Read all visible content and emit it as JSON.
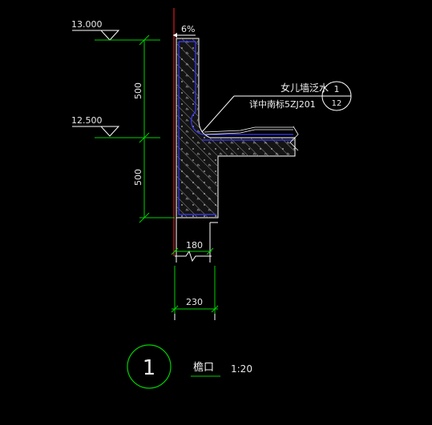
{
  "elevations": {
    "top": "13.000",
    "middle": "12.500"
  },
  "dimensions": {
    "upper_height": "500",
    "lower_height": "500",
    "parapet_thickness": "180",
    "wall_thickness": "230"
  },
  "slope": "6%",
  "annotations": {
    "parapet_waterproof": "女儿墙泛水",
    "reference": "详中南标5ZJ201"
  },
  "detail_reference": {
    "number": "1",
    "sheet": "12"
  },
  "title": {
    "number": "1",
    "name": "檐口",
    "scale": "1:20"
  },
  "colors": {
    "background": "#000000",
    "concrete_outline": "#ffffff",
    "waterproof_line": "#3a3aff",
    "dimension": "#00d000",
    "axis": "#ff2020",
    "hatch": "#888888"
  }
}
